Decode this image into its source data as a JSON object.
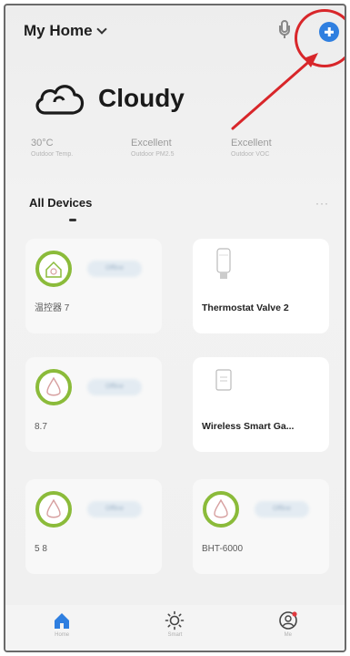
{
  "header": {
    "home_name": "My Home"
  },
  "weather": {
    "condition": "Cloudy"
  },
  "stats": [
    {
      "value": "30°C",
      "label": "Outdoor Temp."
    },
    {
      "value": "Excellent",
      "label": "Outdoor PM2.5"
    },
    {
      "value": "Excellent",
      "label": "Outdoor VOC"
    }
  ],
  "devices_section": {
    "title": "All Devices"
  },
  "devices": [
    {
      "name": "温控器 7",
      "status": "Offline"
    },
    {
      "name": "Thermostat Valve 2"
    },
    {
      "name": "8.7",
      "status": "Offline"
    },
    {
      "name": "Wireless Smart Ga..."
    },
    {
      "name": "5 8",
      "status": "Offline"
    },
    {
      "name": "BHT-6000",
      "status": "Offline"
    }
  ],
  "nav": [
    {
      "label": "Home"
    },
    {
      "label": "Smart"
    },
    {
      "label": "Me"
    }
  ],
  "colors": {
    "accent": "#2f7fe0",
    "annotation": "#d8262a",
    "device_green": "#8bbb3a"
  }
}
